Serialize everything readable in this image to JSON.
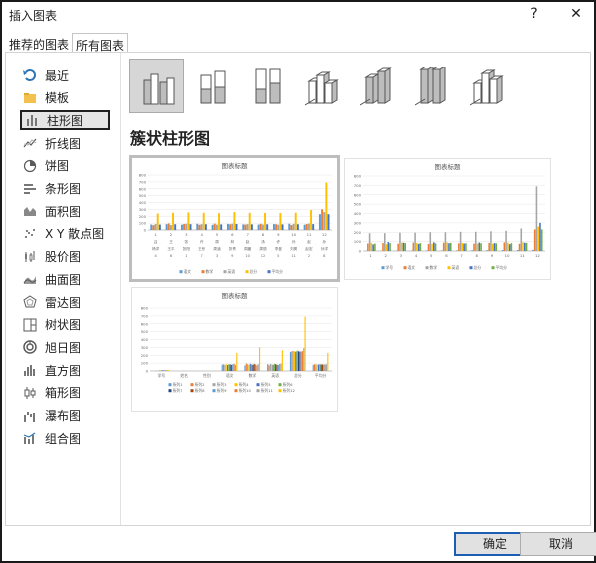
{
  "dialog": {
    "title": "插入图表",
    "help_label": "?",
    "close_label": "✕"
  },
  "tabs": [
    {
      "label": "推荐的图表",
      "active": false
    },
    {
      "label": "所有图表",
      "active": true
    }
  ],
  "sidebar": {
    "items": [
      {
        "label": "最近",
        "icon": "recent-icon"
      },
      {
        "label": "模板",
        "icon": "folder-icon"
      },
      {
        "label": "柱形图",
        "icon": "column-chart-icon",
        "selected": true
      },
      {
        "label": "折线图",
        "icon": "line-chart-icon"
      },
      {
        "label": "饼图",
        "icon": "pie-chart-icon"
      },
      {
        "label": "条形图",
        "icon": "bar-chart-icon"
      },
      {
        "label": "面积图",
        "icon": "area-chart-icon"
      },
      {
        "label": "X Y 散点图",
        "icon": "scatter-chart-icon"
      },
      {
        "label": "股价图",
        "icon": "stock-chart-icon"
      },
      {
        "label": "曲面图",
        "icon": "surface-chart-icon"
      },
      {
        "label": "雷达图",
        "icon": "radar-chart-icon"
      },
      {
        "label": "树状图",
        "icon": "treemap-icon"
      },
      {
        "label": "旭日图",
        "icon": "sunburst-icon"
      },
      {
        "label": "直方图",
        "icon": "histogram-icon"
      },
      {
        "label": "箱形图",
        "icon": "box-whisker-icon"
      },
      {
        "label": "瀑布图",
        "icon": "waterfall-icon"
      },
      {
        "label": "组合图",
        "icon": "combo-chart-icon"
      }
    ]
  },
  "subtypes": [
    {
      "icon": "clustered-column-icon",
      "selected": true
    },
    {
      "icon": "stacked-column-icon"
    },
    {
      "icon": "percent-stacked-column-icon"
    },
    {
      "icon": "3d-clustered-column-icon"
    },
    {
      "icon": "3d-stacked-column-icon"
    },
    {
      "icon": "3d-percent-stacked-column-icon"
    },
    {
      "icon": "3d-column-icon"
    }
  ],
  "main": {
    "heading": "簇状柱形图"
  },
  "colors": {
    "s1": "#5b9bd5",
    "s2": "#ed7d31",
    "s3": "#a5a5a5",
    "s4": "#ffc000",
    "s5": "#4472c4",
    "s6": "#70ad47",
    "s7": "#264478",
    "s8": "#9e480e",
    "accent": "#1a5fb4"
  },
  "previews": [
    {
      "title": "图表标题",
      "chart_data": {
        "type": "bar",
        "title": "图表标题",
        "ylim": [
          0,
          800
        ],
        "yticks": [
          "0",
          "100",
          "200",
          "300",
          "400",
          "500",
          "600",
          "700",
          "800"
        ],
        "categories": [
          "1",
          "2",
          "3",
          "4",
          "5",
          "6",
          "7",
          "8",
          "9",
          "10",
          "11",
          "12"
        ],
        "category_rows": [
          [
            "吕",
            "王",
            "张",
            "许",
            "周",
            "林",
            "赵",
            "汤",
            "许",
            "孙",
            "赵",
            "孙"
          ],
          [
            "杨洋",
            "王平",
            "张阳",
            "王彤",
            "周涵",
            "张青",
            "周媛",
            "周丽",
            "李曼",
            "刘昊",
            "赵宏",
            "孙洋"
          ],
          [
            "4",
            "6",
            "1",
            "7",
            "3",
            "9",
            "10",
            "12",
            "5",
            "11",
            "2",
            "8"
          ]
        ],
        "series": [
          {
            "name": "语文",
            "values": [
              80,
              85,
              78,
              90,
              75,
              88,
              82,
              79,
              86,
              91,
              77,
              230
            ]
          },
          {
            "name": "数学",
            "values": [
              70,
              95,
              88,
              76,
              92,
              83,
              79,
              90,
              84,
              72,
              88,
              300
            ]
          },
          {
            "name": "英语",
            "values": [
              88,
              72,
              90,
              85,
              78,
              91,
              86,
              80,
              77,
              89,
              93,
              260
            ]
          },
          {
            "name": "总分",
            "values": [
              240,
              250,
              255,
              250,
              245,
              260,
              250,
              248,
              247,
              252,
              290,
              690
            ]
          },
          {
            "name": "平均分",
            "values": [
              79,
              84,
              85,
              84,
              82,
              87,
              83,
              83,
              82,
              84,
              86,
              230
            ]
          }
        ],
        "legend": "bottom"
      }
    },
    {
      "title": "图表标题",
      "chart_data": {
        "type": "bar",
        "title": "图表标题",
        "ylim": [
          0,
          800
        ],
        "yticks": [
          "0",
          "100",
          "200",
          "300",
          "400",
          "500",
          "600",
          "700",
          "800"
        ],
        "categories": [
          "1",
          "2",
          "3",
          "4",
          "5",
          "6",
          "7",
          "8",
          "9",
          "10",
          "11",
          "12"
        ],
        "series": [
          {
            "name": "学号",
            "values": [
              1,
              2,
              3,
              4,
              5,
              6,
              7,
              8,
              9,
              10,
              11,
              12
            ]
          },
          {
            "name": "语文",
            "values": [
              80,
              85,
              78,
              90,
              75,
              88,
              82,
              79,
              86,
              91,
              77,
              230
            ]
          },
          {
            "name": "数学",
            "values": [
              190,
              190,
              195,
              195,
              200,
              200,
              205,
              205,
              210,
              215,
              240,
              690
            ]
          },
          {
            "name": "英语",
            "values": [
              88,
              72,
              90,
              85,
              78,
              91,
              86,
              80,
              77,
              89,
              93,
              260
            ]
          },
          {
            "name": "总分",
            "values": [
              70,
              95,
              88,
              76,
              92,
              83,
              79,
              90,
              84,
              72,
              88,
              300
            ]
          },
          {
            "name": "平均分",
            "values": [
              79,
              84,
              85,
              84,
              82,
              87,
              83,
              83,
              82,
              84,
              86,
              230
            ]
          }
        ],
        "legend": "bottom"
      }
    },
    {
      "title": "图表标题",
      "chart_data": {
        "type": "bar",
        "title": "图表标题",
        "ylim": [
          0,
          800
        ],
        "yticks": [
          "0",
          "100",
          "200",
          "300",
          "400",
          "500",
          "600",
          "700",
          "800"
        ],
        "categories": [
          "学号",
          "姓名",
          "性别",
          "语文",
          "数学",
          "英语",
          "总分",
          "平均分"
        ],
        "series": [
          {
            "name": "系列1",
            "values": [
              1,
              0,
              0,
              80,
              70,
              88,
              240,
              79
            ]
          },
          {
            "name": "系列2",
            "values": [
              2,
              0,
              0,
              85,
              95,
              72,
              250,
              84
            ]
          },
          {
            "name": "系列3",
            "values": [
              3,
              0,
              0,
              78,
              88,
              90,
              255,
              85
            ]
          },
          {
            "name": "系列4",
            "values": [
              4,
              0,
              0,
              90,
              76,
              85,
              250,
              84
            ]
          },
          {
            "name": "系列5",
            "values": [
              5,
              0,
              0,
              75,
              92,
              78,
              245,
              82
            ]
          },
          {
            "name": "系列6",
            "values": [
              6,
              0,
              0,
              88,
              83,
              91,
              260,
              87
            ]
          },
          {
            "name": "系列7",
            "values": [
              7,
              0,
              0,
              82,
              79,
              86,
              250,
              83
            ]
          },
          {
            "name": "系列8",
            "values": [
              8,
              0,
              0,
              79,
              90,
              80,
              248,
              83
            ]
          },
          {
            "name": "系列9",
            "values": [
              9,
              0,
              0,
              86,
              84,
              77,
              247,
              82
            ]
          },
          {
            "name": "系列10",
            "values": [
              10,
              0,
              0,
              91,
              72,
              89,
              252,
              84
            ]
          },
          {
            "name": "系列11",
            "values": [
              11,
              0,
              0,
              77,
              88,
              93,
              290,
              86
            ]
          },
          {
            "name": "系列12",
            "values": [
              12,
              0,
              0,
              230,
              300,
              260,
              690,
              230
            ]
          }
        ],
        "legend": "bottom"
      }
    }
  ],
  "footer": {
    "ok_label": "确定",
    "cancel_label": "取消"
  }
}
